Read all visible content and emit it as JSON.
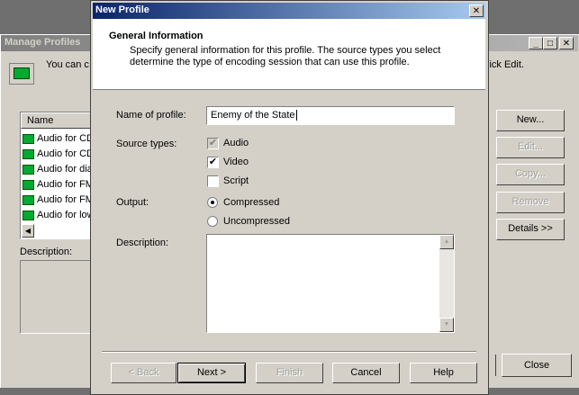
{
  "manage": {
    "title": "Manage Profiles",
    "intro_left": "You can c",
    "intro_right": "lick Edit.",
    "list_header": "Name",
    "items": [
      "Audio for CD",
      "Audio for CD",
      "Audio for dia",
      "Audio for FM",
      "Audio for FM",
      "Audio for low"
    ],
    "description_label": "Description:",
    "buttons": {
      "new": "New...",
      "edit": "Edit...",
      "copy": "Copy...",
      "remove": "Remove",
      "details": "Details >>",
      "close": "Close"
    },
    "caption": {
      "minimize": "_",
      "maximize": "□",
      "close": "✕"
    }
  },
  "dialog": {
    "title": "New Profile",
    "close_glyph": "✕",
    "section_title": "General Information",
    "section_desc_1": "Specify general information for this profile. The source types you select",
    "section_desc_2": "determine the type of encoding session that can use this profile.",
    "name_label": "Name of profile:",
    "name_value": "Enemy of the State",
    "source_label": "Source types:",
    "sources": [
      {
        "label": "Audio",
        "checked": true,
        "disabled": true
      },
      {
        "label": "Video",
        "checked": true,
        "disabled": false
      },
      {
        "label": "Script",
        "checked": false,
        "disabled": false
      }
    ],
    "output_label": "Output:",
    "outputs": [
      {
        "label": "Compressed",
        "selected": true
      },
      {
        "label": "Uncompressed",
        "selected": false
      }
    ],
    "description_label": "Description:",
    "description_value": "",
    "buttons": {
      "back": "< Back",
      "next": "Next >",
      "finish": "Finish",
      "cancel": "Cancel",
      "help": "Help"
    },
    "check_glyph": "✔"
  }
}
